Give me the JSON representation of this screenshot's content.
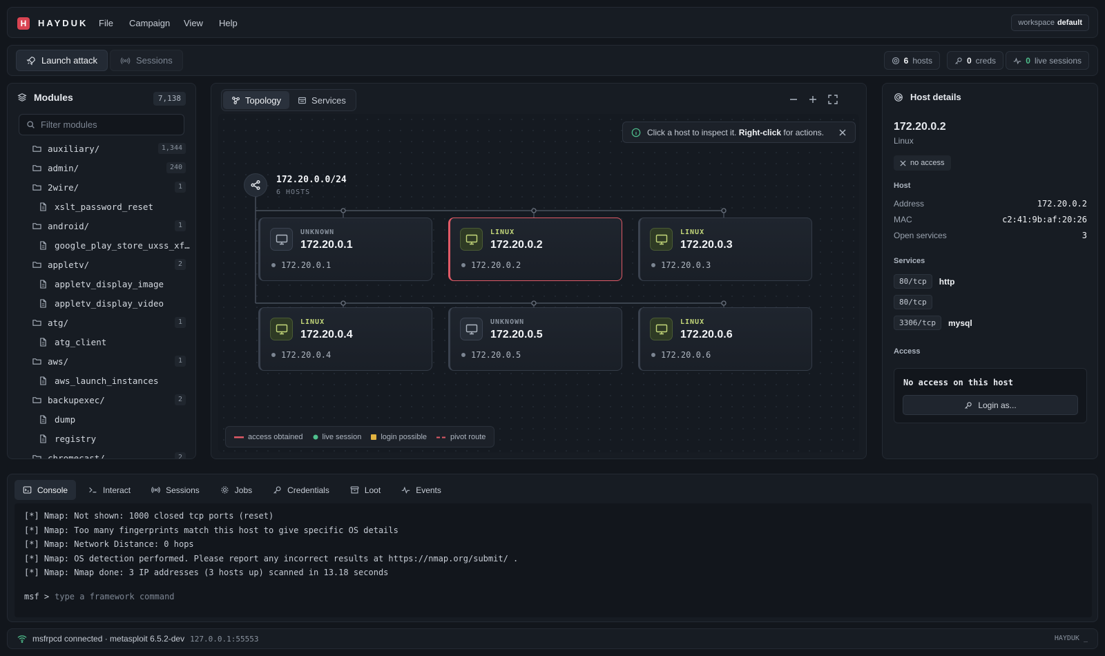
{
  "app": {
    "logo_letter": "H",
    "name": "HAYDUK",
    "menu": [
      "File",
      "Campaign",
      "View",
      "Help"
    ],
    "workspace_label": "workspace",
    "workspace_value": "default"
  },
  "toolbar": {
    "launch_label": "Launch attack",
    "sessions_label": "Sessions",
    "stats": {
      "hosts_count": "6",
      "hosts_label": "hosts",
      "creds_count": "0",
      "creds_label": "creds",
      "sessions_count": "0",
      "sessions_label": "live sessions"
    }
  },
  "modules": {
    "title": "Modules",
    "count": "7,138",
    "filter_placeholder": "Filter modules",
    "tree": [
      {
        "type": "folder",
        "name": "auxiliary/",
        "count": "1,344"
      },
      {
        "type": "folder",
        "name": "admin/",
        "count": "240"
      },
      {
        "type": "folder",
        "name": "2wire/",
        "count": "1"
      },
      {
        "type": "file",
        "name": "xslt_password_reset"
      },
      {
        "type": "folder",
        "name": "android/",
        "count": "1"
      },
      {
        "type": "file",
        "name": "google_play_store_uxss_xf…"
      },
      {
        "type": "folder",
        "name": "appletv/",
        "count": "2"
      },
      {
        "type": "file",
        "name": "appletv_display_image"
      },
      {
        "type": "file",
        "name": "appletv_display_video"
      },
      {
        "type": "folder",
        "name": "atg/",
        "count": "1"
      },
      {
        "type": "file",
        "name": "atg_client"
      },
      {
        "type": "folder",
        "name": "aws/",
        "count": "1"
      },
      {
        "type": "file",
        "name": "aws_launch_instances"
      },
      {
        "type": "folder",
        "name": "backupexec/",
        "count": "2"
      },
      {
        "type": "file",
        "name": "dump"
      },
      {
        "type": "file",
        "name": "registry"
      },
      {
        "type": "folder",
        "name": "chromecast/",
        "count": "2"
      }
    ]
  },
  "topology": {
    "tabs": [
      "Topology",
      "Services"
    ],
    "hint_prefix": "Click a host to inspect it.",
    "hint_bold": "Right-click",
    "hint_suffix": "for actions.",
    "subnet_cidr": "172.20.0.0/24",
    "subnet_hosts": "6 HOSTS",
    "hosts": [
      {
        "os": "UNKNOWN",
        "ip": "172.20.0.1",
        "addr": "172.20.0.1",
        "linux": false,
        "selected": false
      },
      {
        "os": "LINUX",
        "ip": "172.20.0.2",
        "addr": "172.20.0.2",
        "linux": true,
        "selected": true
      },
      {
        "os": "LINUX",
        "ip": "172.20.0.3",
        "addr": "172.20.0.3",
        "linux": true,
        "selected": false
      },
      {
        "os": "LINUX",
        "ip": "172.20.0.4",
        "addr": "172.20.0.4",
        "linux": true,
        "selected": false
      },
      {
        "os": "UNKNOWN",
        "ip": "172.20.0.5",
        "addr": "172.20.0.5",
        "linux": false,
        "selected": false
      },
      {
        "os": "LINUX",
        "ip": "172.20.0.6",
        "addr": "172.20.0.6",
        "linux": true,
        "selected": false
      }
    ],
    "legend": [
      {
        "label": "access obtained",
        "color": "#e05a66",
        "shape": "line"
      },
      {
        "label": "live session",
        "color": "#4fc08d",
        "shape": "dot"
      },
      {
        "label": "login possible",
        "color": "#e2b340",
        "shape": "square"
      },
      {
        "label": "pivot route",
        "color": "#e05a66",
        "shape": "dash"
      }
    ]
  },
  "details": {
    "title": "Host details",
    "ip": "172.20.0.2",
    "os": "Linux",
    "badge": "no access",
    "host_section": "Host",
    "address_label": "Address",
    "address": "172.20.0.2",
    "mac_label": "MAC",
    "mac": "c2:41:9b:af:20:26",
    "open_label": "Open services",
    "open_count": "3",
    "services_section": "Services",
    "services": [
      {
        "port": "80/tcp",
        "name": "http"
      },
      {
        "port": "80/tcp",
        "name": ""
      },
      {
        "port": "3306/tcp",
        "name": "mysql"
      }
    ],
    "access_section": "Access",
    "access_msg": "No access on this host",
    "login_label": "Login as..."
  },
  "console": {
    "tabs": [
      "Console",
      "Interact",
      "Sessions",
      "Jobs",
      "Credentials",
      "Loot",
      "Events"
    ],
    "lines": [
      "[*] Nmap: Not shown: 1000 closed tcp ports (reset)",
      "[*] Nmap: Too many fingerprints match this host to give specific OS details",
      "[*] Nmap: Network Distance: 0 hops",
      "[*] Nmap: OS detection performed. Please report any incorrect results at https://nmap.org/submit/ .",
      "[*] Nmap: Nmap done: 3 IP addresses (3 hosts up) scanned in 13.18 seconds"
    ],
    "prompt": "msf >",
    "placeholder": "type a framework command"
  },
  "status": {
    "connection": "msfrpcd connected · metasploit 6.5.2-dev",
    "address": "127.0.0.1:55553",
    "right": "HAYDUK _"
  },
  "colors": {
    "accent_red": "#e05a66",
    "linux_green": "#c5d97a",
    "live_green": "#4fc08d",
    "login_yellow": "#e2b340"
  }
}
